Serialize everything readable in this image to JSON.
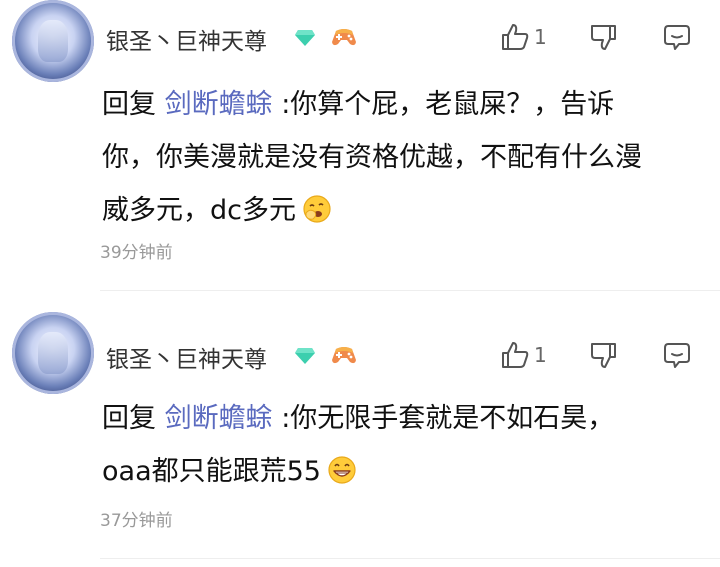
{
  "comments": [
    {
      "username": "银圣丶巨神天尊",
      "likes": "1",
      "reply_prefix": "回复",
      "mention": "剑断蟾蜍",
      "text_line1": ":你算个屁，老鼠屎？，告诉",
      "text_line2": "你，你美漫就是没有资格优越，不配有什么漫",
      "text_line3": "威多元，dc多元",
      "time": "39分钟前"
    },
    {
      "username": "银圣丶巨神天尊",
      "likes": "1",
      "reply_prefix": "回复",
      "mention": "剑断蟾蜍",
      "text_line1": ":你无限手套就是不如石昊，",
      "text_line2": "oaa都只能跟荒55",
      "time": "37分钟前"
    }
  ],
  "icons": {
    "like": "thumbs-up-icon",
    "dislike": "thumbs-down-icon",
    "reply": "comment-bubble-icon",
    "level_badge": "diamond-badge-icon",
    "game_badge": "gamepad-icon"
  },
  "colors": {
    "mention": "#5a6abf",
    "badge_green": "#3ccfae",
    "badge_orange": "#f08a4b"
  }
}
